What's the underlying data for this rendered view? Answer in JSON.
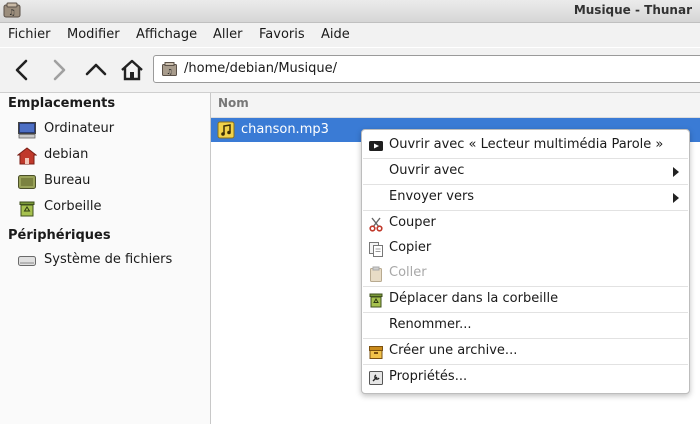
{
  "window": {
    "title": "Musique - Thunar"
  },
  "menubar": [
    "Fichier",
    "Modifier",
    "Affichage",
    "Aller",
    "Favoris",
    "Aide"
  ],
  "toolbar": {
    "location": "/home/debian/Musique/"
  },
  "sidebar": {
    "places_header": "Emplacements",
    "places": [
      {
        "label": "Ordinateur",
        "icon": "computer-icon"
      },
      {
        "label": "debian",
        "icon": "home-folder-icon"
      },
      {
        "label": "Bureau",
        "icon": "desktop-icon"
      },
      {
        "label": "Corbeille",
        "icon": "trash-icon"
      }
    ],
    "devices_header": "Périphériques",
    "devices": [
      {
        "label": "Système de fichiers",
        "icon": "drive-icon"
      }
    ]
  },
  "filelist": {
    "column_name": "Nom",
    "files": [
      {
        "name": "chanson.mp3",
        "icon": "audio-file-icon",
        "selected": true
      }
    ]
  },
  "context_menu": {
    "items": [
      {
        "label": "Ouvrir avec « Lecteur multimédia Parole »",
        "icon": "media-player-icon"
      },
      {
        "label": "Ouvrir avec",
        "submenu": true
      },
      {
        "label": "Envoyer vers",
        "submenu": true
      },
      {
        "label": "Couper",
        "icon": "scissors-icon"
      },
      {
        "label": "Copier",
        "icon": "copy-icon"
      },
      {
        "label": "Coller",
        "icon": "paste-icon",
        "disabled": true
      },
      {
        "label": "Déplacer dans la corbeille",
        "icon": "trash-icon"
      },
      {
        "label": "Renommer..."
      },
      {
        "label": "Créer une archive...",
        "icon": "archive-icon"
      },
      {
        "label": "Propriétés...",
        "icon": "properties-icon"
      }
    ]
  },
  "colors": {
    "selection": "#3a7bd5",
    "menu_bg": "#ffffff",
    "window_bg": "#f2f2f2"
  }
}
